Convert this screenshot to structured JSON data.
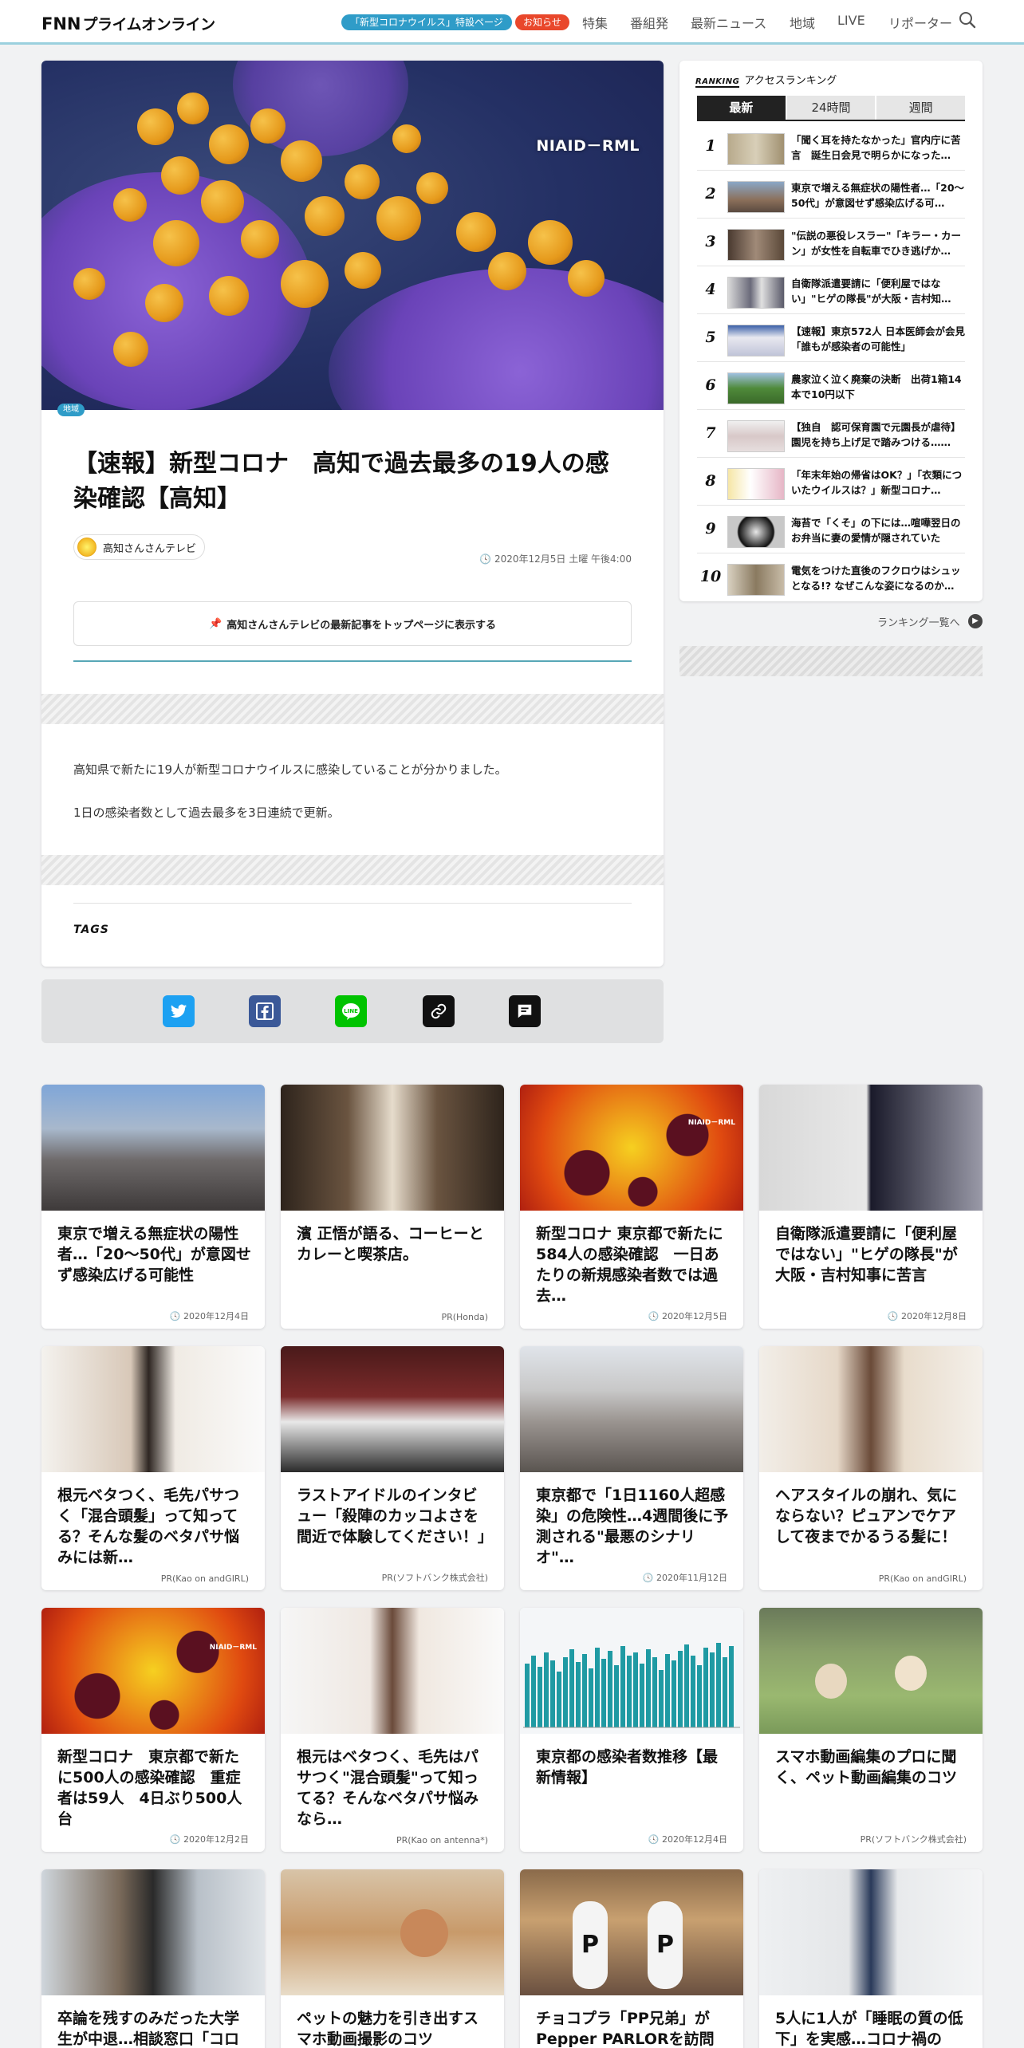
{
  "header": {
    "logo_mark": "FNN",
    "logo_text": "プライムオンライン",
    "special_label": "「新型コロナウイルス」特設ページ",
    "notice_label": "お知らせ",
    "nav": [
      "特集",
      "番組発",
      "最新ニュース",
      "地域",
      "LIVE",
      "リポーター"
    ]
  },
  "article": {
    "hero_caption": "NIAID－RML",
    "category": "地域",
    "title": "【速報】新型コロナ　高知で過去最多の19人の感染確認【高知】",
    "source": "高知さんさんテレビ",
    "date": "2020年12月5日 土曜 午後4:00",
    "pin_label": "高知さんさんテレビの最新記事をトップページに表示する",
    "paragraphs": [
      "高知県で新たに19人が新型コロナウイルスに感染していることが分かりました。",
      "1日の感染者数として過去最多を3日連続で更新。"
    ],
    "tags_label": "TAGS"
  },
  "share": {
    "twitter": "twitter-icon",
    "facebook": "facebook-icon",
    "line": "line-icon",
    "link": "link-icon",
    "comment": "comment-icon",
    "colors": {
      "twitter": "#1da1f2",
      "facebook": "#3b5998",
      "line": "#00c300",
      "link": "#111111",
      "comment": "#111111"
    }
  },
  "ranking": {
    "heading_mark": "RANKING",
    "heading": "アクセスランキング",
    "tabs": [
      "最新",
      "24時間",
      "週間"
    ],
    "items": [
      {
        "rank": "1",
        "text": "「聞く耳を持たなかった」官内庁に苦言　誕生日会見で明らかになった…"
      },
      {
        "rank": "2",
        "text": "東京で増える無症状の陽性者…「20～50代」が意図せず感染広げる可…"
      },
      {
        "rank": "3",
        "text": "\"伝説の悪役レスラー\"「キラー・カーン」が女性を自転車でひき逃げか…"
      },
      {
        "rank": "4",
        "text": "自衛隊派遣要請に「便利屋ではない」\"ヒゲの隊長\"が大阪・吉村知…"
      },
      {
        "rank": "5",
        "text": "【速報】東京572人 日本医師会が会見　「誰もが感染者の可能性」"
      },
      {
        "rank": "6",
        "text": "農家泣く泣く廃棄の決断　出荷1箱14本で10円以下"
      },
      {
        "rank": "7",
        "text": "【独自　認可保育園で元園長が虐待】園児を持ち上げ足で踏みつける……"
      },
      {
        "rank": "8",
        "text": "「年末年始の帰省はOK？」「衣類についたウイルスは？」新型コロナ…"
      },
      {
        "rank": "9",
        "text": "海苔で「くそ」の下には…喧嘩翌日のお弁当に妻の愛情が隠されていた"
      },
      {
        "rank": "10",
        "text": "電気をつけた直後のフクロウはシュッとなる!? なぜこんな姿になるのか…"
      }
    ],
    "more_label": "ランキング一覧へ"
  },
  "cards": [
    {
      "title": "東京で増える無症状の陽性者…「20～50代」が意図せず感染広げる可能性",
      "meta": "2020年12月4日"
    },
    {
      "title": "濱 正悟が語る、コーヒーとカレーと喫茶店。",
      "meta": "PR(Honda)"
    },
    {
      "title": "新型コロナ 東京都で新たに584人の感染確認　一日あたりの新規感染者数では過去…",
      "meta": "2020年12月5日",
      "img_caption": "NIAID－RML"
    },
    {
      "title": "自衛隊派遣要請に「便利屋ではない」\"ヒゲの隊長\"が大阪・吉村知事に苦言",
      "meta": "2020年12月8日"
    },
    {
      "title": "根元ベタつく、毛先パサつく「混合頭髪」って知ってる？そんな髪のベタパサ悩みには新…",
      "meta": "PR(Kao on andGIRL)"
    },
    {
      "title": "ラストアイドルのインタビュー「殺陣のカッコよさを間近で体験してください！」",
      "meta": "PR(ソフトバンク株式会社)"
    },
    {
      "title": "東京都で「1日1160人超感染」の危険性…4週間後に予測される\"最悪のシナリオ\"…",
      "meta": "2020年11月12日"
    },
    {
      "title": "ヘアスタイルの崩れ、気にならない？ピュアンでケアして夜までかるうる髪に！",
      "meta": "PR(Kao on andGIRL)"
    },
    {
      "title": "新型コロナ　東京都で新たに500人の感染確認　重症者は59人　4日ぶり500人台",
      "meta": "2020年12月2日",
      "img_caption": "NIAID－RML"
    },
    {
      "title": "根元はベタつく、毛先はパサつく\"混合頭髪\"って知ってる？そんなベタパサ悩みなら…",
      "meta": "PR(Kao on antenna*)"
    },
    {
      "title": "東京都の感染者数推移【最新情報】",
      "meta": "2020年12月4日"
    },
    {
      "title": "スマホ動画編集のプロに聞く、ペット動画編集のコツ",
      "meta": "PR(ソフトバンク株式会社)"
    },
    {
      "title": "卒論を残すのみだった大学生が中退…相談窓口「コロ",
      "meta": ""
    },
    {
      "title": "ペットの魅力を引き出すスマホ動画撮影のコツ",
      "meta": ""
    },
    {
      "title": "チョコプラ「PP兄弟」がPepper PARLORを訪問",
      "meta": ""
    },
    {
      "title": "5人に1人が「睡眠の質の低下」を実感…コロナ禍の",
      "meta": ""
    }
  ]
}
